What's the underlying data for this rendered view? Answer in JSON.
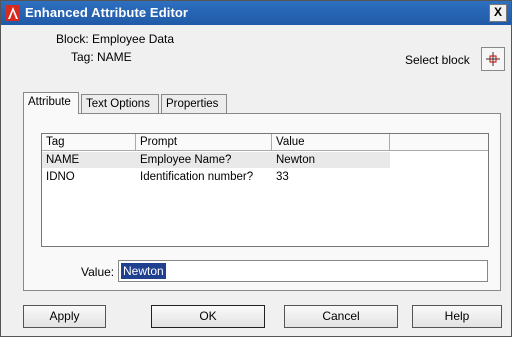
{
  "window": {
    "title": "Enhanced Attribute Editor",
    "close_label": "X"
  },
  "info": {
    "block_line": "Block: Employee Data",
    "tag_line": "Tag: NAME"
  },
  "select_block": {
    "label": "Select block"
  },
  "tabs": [
    {
      "label": "Attribute"
    },
    {
      "label": "Text Options"
    },
    {
      "label": "Properties"
    }
  ],
  "table": {
    "headers": {
      "tag": "Tag",
      "prompt": "Prompt",
      "value": "Value"
    },
    "rows": [
      {
        "tag": "NAME",
        "prompt": "Employee Name?",
        "value": "Newton"
      },
      {
        "tag": "IDNO",
        "prompt": "Identification number?",
        "value": "33"
      }
    ]
  },
  "value_field": {
    "label": "Value:",
    "value": "Newton"
  },
  "buttons": {
    "apply": "Apply",
    "ok": "OK",
    "cancel": "Cancel",
    "help": "Help"
  },
  "colors": {
    "titlebar": "#1f5aa8",
    "selection": "#1f3f8f",
    "app_icon": "#d62b1e"
  }
}
